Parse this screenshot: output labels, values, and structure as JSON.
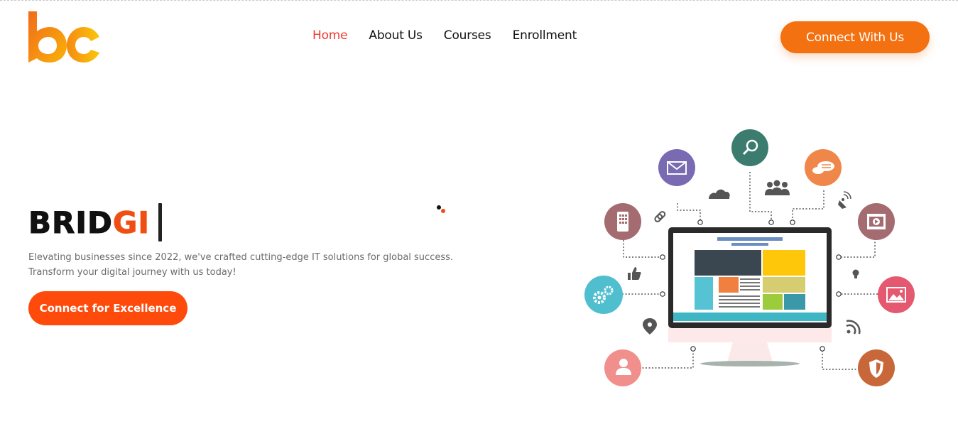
{
  "brand": {
    "logo_text": "bc",
    "primary_color": "#f47112",
    "accent_color": "#fe4a0b"
  },
  "nav": {
    "items": [
      {
        "label": "Home",
        "active": true
      },
      {
        "label": "About Us",
        "active": false
      },
      {
        "label": "Courses",
        "active": false
      },
      {
        "label": "Enrollment",
        "active": false
      }
    ]
  },
  "header_cta": {
    "label": "Connect With Us"
  },
  "hero": {
    "title_main": "BRID",
    "title_highlight": "GI",
    "subtitle_line1": "Elevating businesses since 2022, we've crafted cutting-edge IT solutions for global success.",
    "subtitle_line2": "Transform your digital journey with us today!",
    "button_label": "Connect for Excellence"
  },
  "illustration": {
    "icons": [
      "mail-icon",
      "search-icon",
      "chat-icon",
      "mobile-icon",
      "video-icon",
      "settings-icon",
      "image-icon",
      "user-icon",
      "shield-icon",
      "cloud-icon",
      "users-icon",
      "satellite-icon",
      "link-icon",
      "thumbs-up-icon",
      "bulb-icon",
      "location-icon",
      "rss-icon"
    ]
  }
}
